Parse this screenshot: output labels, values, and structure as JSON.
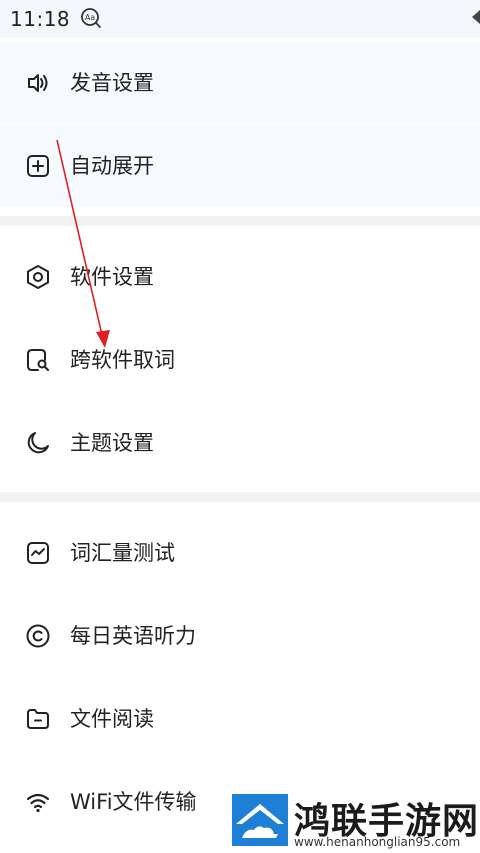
{
  "status_bar": {
    "time": "11:18",
    "icons": [
      "aa-translate-icon",
      "signal-icon"
    ]
  },
  "menu": {
    "group1": [
      {
        "label": "发音设置",
        "icon": "speaker-icon"
      },
      {
        "label": "自动展开",
        "icon": "plus-square-icon"
      }
    ],
    "group2": [
      {
        "label": "软件设置",
        "icon": "hexagon-settings-icon"
      },
      {
        "label": "跨软件取词",
        "icon": "search-square-icon"
      },
      {
        "label": "主题设置",
        "icon": "moon-icon"
      }
    ],
    "group3": [
      {
        "label": "词汇量测试",
        "icon": "trend-square-icon"
      },
      {
        "label": "每日英语听力",
        "icon": "copyright-circle-icon"
      },
      {
        "label": "文件阅读",
        "icon": "folder-icon"
      },
      {
        "label": "WiFi文件传输",
        "icon": "wifi-icon"
      }
    ]
  },
  "annotation": {
    "arrow_color": "#e02020"
  },
  "watermark": {
    "title": "鸿联手游网",
    "url": "www.henanhonglian95.com",
    "logo_color": "#1e7fd6"
  }
}
